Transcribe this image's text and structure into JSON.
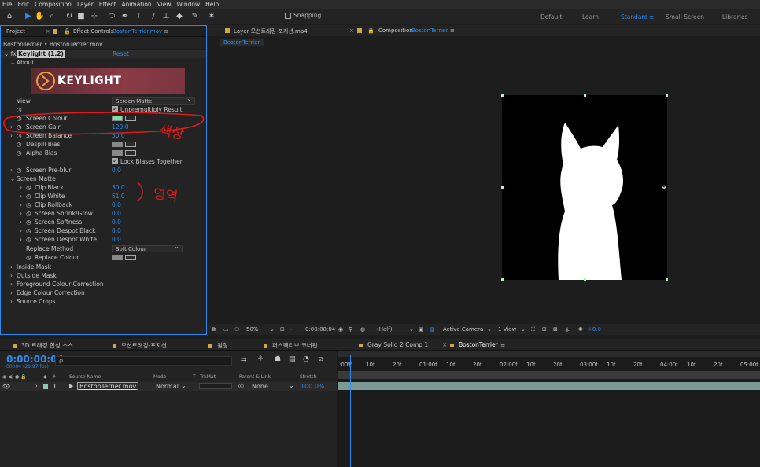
{
  "menu": [
    "File",
    "Edit",
    "Composition",
    "Layer",
    "Effect",
    "Animation",
    "View",
    "Window",
    "Help"
  ],
  "toolbar": {
    "snapping": "Snapping",
    "workspaces": [
      "Default",
      "Learn",
      "Standard",
      "Small Screen",
      "Libraries"
    ],
    "active_workspace": "Standard"
  },
  "left_panel": {
    "tab_project": "Project",
    "tab_effect_controls": "Effect Controls",
    "tab_file": "BostonTerrier.mov",
    "breadcrumb": "BostonTerrier • BostonTerrier.mov",
    "effect_name": "Keylight (1.2)",
    "reset": "Reset",
    "about": "About",
    "banner": "KEYLIGHT",
    "view_label": "View",
    "view_value": "Screen Matte",
    "unpremultiply": "Unpremultiply Result",
    "screen_colour": "Screen Colour",
    "screen_colour_hex": "#7de0a0",
    "screen_gain": "Screen Gain",
    "screen_gain_value": "120.0",
    "screen_balance": "Screen Balance",
    "screen_balance_value": "50.0",
    "despill_bias": "Despill Bias",
    "alpha_bias": "Alpha Bias",
    "lock_biases": "Lock Biases Together",
    "screen_preblur": "Screen Pre-blur",
    "screen_preblur_value": "0.0",
    "screen_matte": "Screen Matte",
    "clip_black": "Clip Black",
    "clip_black_value": "30.0",
    "clip_white": "Clip White",
    "clip_white_value": "51.0",
    "clip_rollback": "Clip Rollback",
    "clip_rollback_value": "0.0",
    "shrink_grow": "Screen Shrink/Grow",
    "shrink_grow_value": "0.0",
    "softness": "Screen Softness",
    "softness_value": "0.0",
    "despot_black": "Screen Despot Black",
    "despot_black_value": "0.0",
    "despot_white": "Screen Despot White",
    "despot_white_value": "0.0",
    "replace_method": "Replace Method",
    "replace_method_value": "Soft Colour",
    "replace_colour": "Replace Colour",
    "inside_mask": "Inside Mask",
    "outside_mask": "Outside Mask",
    "fg_colour_correction": "Foreground Colour Correction",
    "edge_colour_correction": "Edge Colour Correction",
    "source_crops": "Source Crops",
    "annotation_colour": "색상",
    "annotation_area": "영역"
  },
  "viewer": {
    "tab_layer": "Layer 모션트래킹-포지션.mp4",
    "tab_comp_prefix": "Composition",
    "tab_comp_name": "BostonTerrier",
    "sub_tab": "BostonTerrier",
    "zoom": "50%",
    "time": "0:00:00:04",
    "resolution": "(Half)",
    "camera": "Active Camera",
    "views": "1 View",
    "exposure": "+0.0"
  },
  "timeline": {
    "tabs": [
      {
        "label": "3D 트래킹 합성 소스",
        "color": "#c8a84a"
      },
      {
        "label": "모션트래킹-포지션",
        "color": "#c8a84a"
      },
      {
        "label": "원형",
        "color": "#c8a84a"
      },
      {
        "label": "퍼스펙티브 코너핀",
        "color": "#c8a84a"
      },
      {
        "label": "Gray Solid 2 Comp 1",
        "color": "#c8a84a"
      },
      {
        "label": "BostonTerrier",
        "color": "#c8a84a"
      }
    ],
    "timecode": "0:00:00:04",
    "fps": "00004 (29.97 fps)",
    "search_placeholder": "ρ.",
    "col_source": "Source Name",
    "col_mode": "Mode",
    "col_t": "T",
    "col_trkmat": "TrkMat",
    "col_parent": "Parent & Link",
    "col_stretch": "Stretch",
    "layer_num": "1",
    "layer_name": "BostonTerrier.mov",
    "layer_mode": "Normal",
    "layer_parent": "None",
    "layer_stretch": "100.0%",
    "ruler": [
      ":00f",
      "10f",
      "20f",
      "01:00f",
      "10f",
      "20f",
      "02:00f",
      "10f",
      "20f",
      "03:00f",
      "10f",
      "20f",
      "04:00f",
      "10f",
      "20f",
      "05:00f"
    ]
  }
}
